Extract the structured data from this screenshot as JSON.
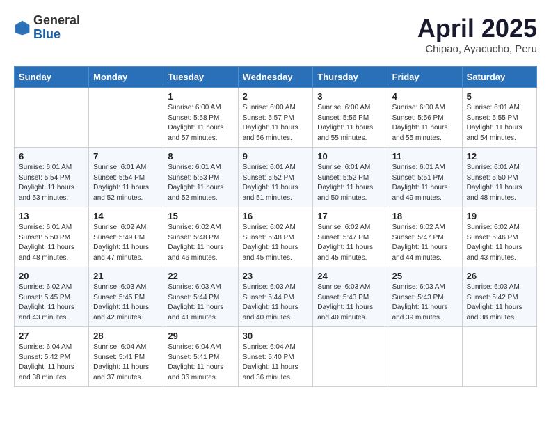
{
  "header": {
    "logo_general": "General",
    "logo_blue": "Blue",
    "month_title": "April 2025",
    "subtitle": "Chipao, Ayacucho, Peru"
  },
  "weekdays": [
    "Sunday",
    "Monday",
    "Tuesday",
    "Wednesday",
    "Thursday",
    "Friday",
    "Saturday"
  ],
  "weeks": [
    [
      {
        "day": "",
        "info": ""
      },
      {
        "day": "",
        "info": ""
      },
      {
        "day": "1",
        "info": "Sunrise: 6:00 AM\nSunset: 5:58 PM\nDaylight: 11 hours and 57 minutes."
      },
      {
        "day": "2",
        "info": "Sunrise: 6:00 AM\nSunset: 5:57 PM\nDaylight: 11 hours and 56 minutes."
      },
      {
        "day": "3",
        "info": "Sunrise: 6:00 AM\nSunset: 5:56 PM\nDaylight: 11 hours and 55 minutes."
      },
      {
        "day": "4",
        "info": "Sunrise: 6:00 AM\nSunset: 5:56 PM\nDaylight: 11 hours and 55 minutes."
      },
      {
        "day": "5",
        "info": "Sunrise: 6:01 AM\nSunset: 5:55 PM\nDaylight: 11 hours and 54 minutes."
      }
    ],
    [
      {
        "day": "6",
        "info": "Sunrise: 6:01 AM\nSunset: 5:54 PM\nDaylight: 11 hours and 53 minutes."
      },
      {
        "day": "7",
        "info": "Sunrise: 6:01 AM\nSunset: 5:54 PM\nDaylight: 11 hours and 52 minutes."
      },
      {
        "day": "8",
        "info": "Sunrise: 6:01 AM\nSunset: 5:53 PM\nDaylight: 11 hours and 52 minutes."
      },
      {
        "day": "9",
        "info": "Sunrise: 6:01 AM\nSunset: 5:52 PM\nDaylight: 11 hours and 51 minutes."
      },
      {
        "day": "10",
        "info": "Sunrise: 6:01 AM\nSunset: 5:52 PM\nDaylight: 11 hours and 50 minutes."
      },
      {
        "day": "11",
        "info": "Sunrise: 6:01 AM\nSunset: 5:51 PM\nDaylight: 11 hours and 49 minutes."
      },
      {
        "day": "12",
        "info": "Sunrise: 6:01 AM\nSunset: 5:50 PM\nDaylight: 11 hours and 48 minutes."
      }
    ],
    [
      {
        "day": "13",
        "info": "Sunrise: 6:01 AM\nSunset: 5:50 PM\nDaylight: 11 hours and 48 minutes."
      },
      {
        "day": "14",
        "info": "Sunrise: 6:02 AM\nSunset: 5:49 PM\nDaylight: 11 hours and 47 minutes."
      },
      {
        "day": "15",
        "info": "Sunrise: 6:02 AM\nSunset: 5:48 PM\nDaylight: 11 hours and 46 minutes."
      },
      {
        "day": "16",
        "info": "Sunrise: 6:02 AM\nSunset: 5:48 PM\nDaylight: 11 hours and 45 minutes."
      },
      {
        "day": "17",
        "info": "Sunrise: 6:02 AM\nSunset: 5:47 PM\nDaylight: 11 hours and 45 minutes."
      },
      {
        "day": "18",
        "info": "Sunrise: 6:02 AM\nSunset: 5:47 PM\nDaylight: 11 hours and 44 minutes."
      },
      {
        "day": "19",
        "info": "Sunrise: 6:02 AM\nSunset: 5:46 PM\nDaylight: 11 hours and 43 minutes."
      }
    ],
    [
      {
        "day": "20",
        "info": "Sunrise: 6:02 AM\nSunset: 5:45 PM\nDaylight: 11 hours and 43 minutes."
      },
      {
        "day": "21",
        "info": "Sunrise: 6:03 AM\nSunset: 5:45 PM\nDaylight: 11 hours and 42 minutes."
      },
      {
        "day": "22",
        "info": "Sunrise: 6:03 AM\nSunset: 5:44 PM\nDaylight: 11 hours and 41 minutes."
      },
      {
        "day": "23",
        "info": "Sunrise: 6:03 AM\nSunset: 5:44 PM\nDaylight: 11 hours and 40 minutes."
      },
      {
        "day": "24",
        "info": "Sunrise: 6:03 AM\nSunset: 5:43 PM\nDaylight: 11 hours and 40 minutes."
      },
      {
        "day": "25",
        "info": "Sunrise: 6:03 AM\nSunset: 5:43 PM\nDaylight: 11 hours and 39 minutes."
      },
      {
        "day": "26",
        "info": "Sunrise: 6:03 AM\nSunset: 5:42 PM\nDaylight: 11 hours and 38 minutes."
      }
    ],
    [
      {
        "day": "27",
        "info": "Sunrise: 6:04 AM\nSunset: 5:42 PM\nDaylight: 11 hours and 38 minutes."
      },
      {
        "day": "28",
        "info": "Sunrise: 6:04 AM\nSunset: 5:41 PM\nDaylight: 11 hours and 37 minutes."
      },
      {
        "day": "29",
        "info": "Sunrise: 6:04 AM\nSunset: 5:41 PM\nDaylight: 11 hours and 36 minutes."
      },
      {
        "day": "30",
        "info": "Sunrise: 6:04 AM\nSunset: 5:40 PM\nDaylight: 11 hours and 36 minutes."
      },
      {
        "day": "",
        "info": ""
      },
      {
        "day": "",
        "info": ""
      },
      {
        "day": "",
        "info": ""
      }
    ]
  ]
}
